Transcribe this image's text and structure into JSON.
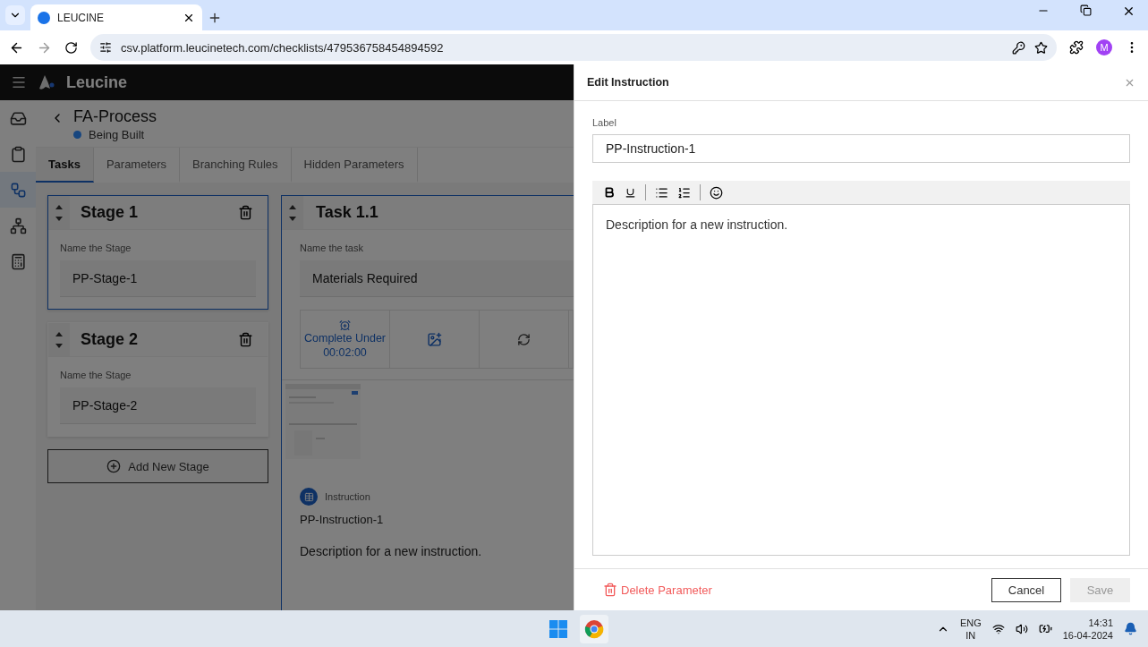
{
  "browser": {
    "tab_title": "LEUCINE",
    "url": "csv.platform.leucinetech.com/checklists/479536758454894592",
    "profile_initial": "M"
  },
  "app": {
    "brand": "Leucine",
    "rail": [
      {
        "kind": "inbox",
        "selected": false
      },
      {
        "kind": "checklist",
        "selected": false
      },
      {
        "kind": "flow",
        "selected": true
      },
      {
        "kind": "hierarchy",
        "selected": false
      },
      {
        "kind": "report",
        "selected": false
      }
    ],
    "title": "FA-Process",
    "status": {
      "label": "Being Built",
      "color": "#17467f"
    },
    "tabs": [
      {
        "label": "Tasks",
        "selected": true
      },
      {
        "label": "Parameters",
        "selected": false
      },
      {
        "label": "Branching Rules",
        "selected": false
      },
      {
        "label": "Hidden Parameters",
        "selected": false
      }
    ],
    "stages": [
      {
        "title": "Stage 1",
        "field_label": "Name the Stage",
        "value": "PP-Stage-1",
        "selected": true
      },
      {
        "title": "Stage 2",
        "field_label": "Name the Stage",
        "value": "PP-Stage-2",
        "selected": false
      }
    ],
    "add_stage": "Add New Stage",
    "task": {
      "title": "Task 1.1",
      "field_label": "Name the task",
      "value": "Materials Required",
      "timer_label": "Complete Under",
      "timer_value": "00:02:00",
      "instruction": {
        "type_label": "Instruction",
        "name": "PP-Instruction-1",
        "description": "Description for a new instruction."
      }
    }
  },
  "drawer": {
    "title": "Edit Instruction",
    "label_caption": "Label",
    "label_value": "PP-Instruction-1",
    "description": "Description for a new instruction.",
    "delete": "Delete Parameter",
    "cancel": "Cancel",
    "save": {
      "label": "Save",
      "disabled": true
    }
  },
  "taskbar": {
    "lang": "ENG",
    "region": "IN",
    "time": "14:31",
    "date": "16-04-2024"
  }
}
